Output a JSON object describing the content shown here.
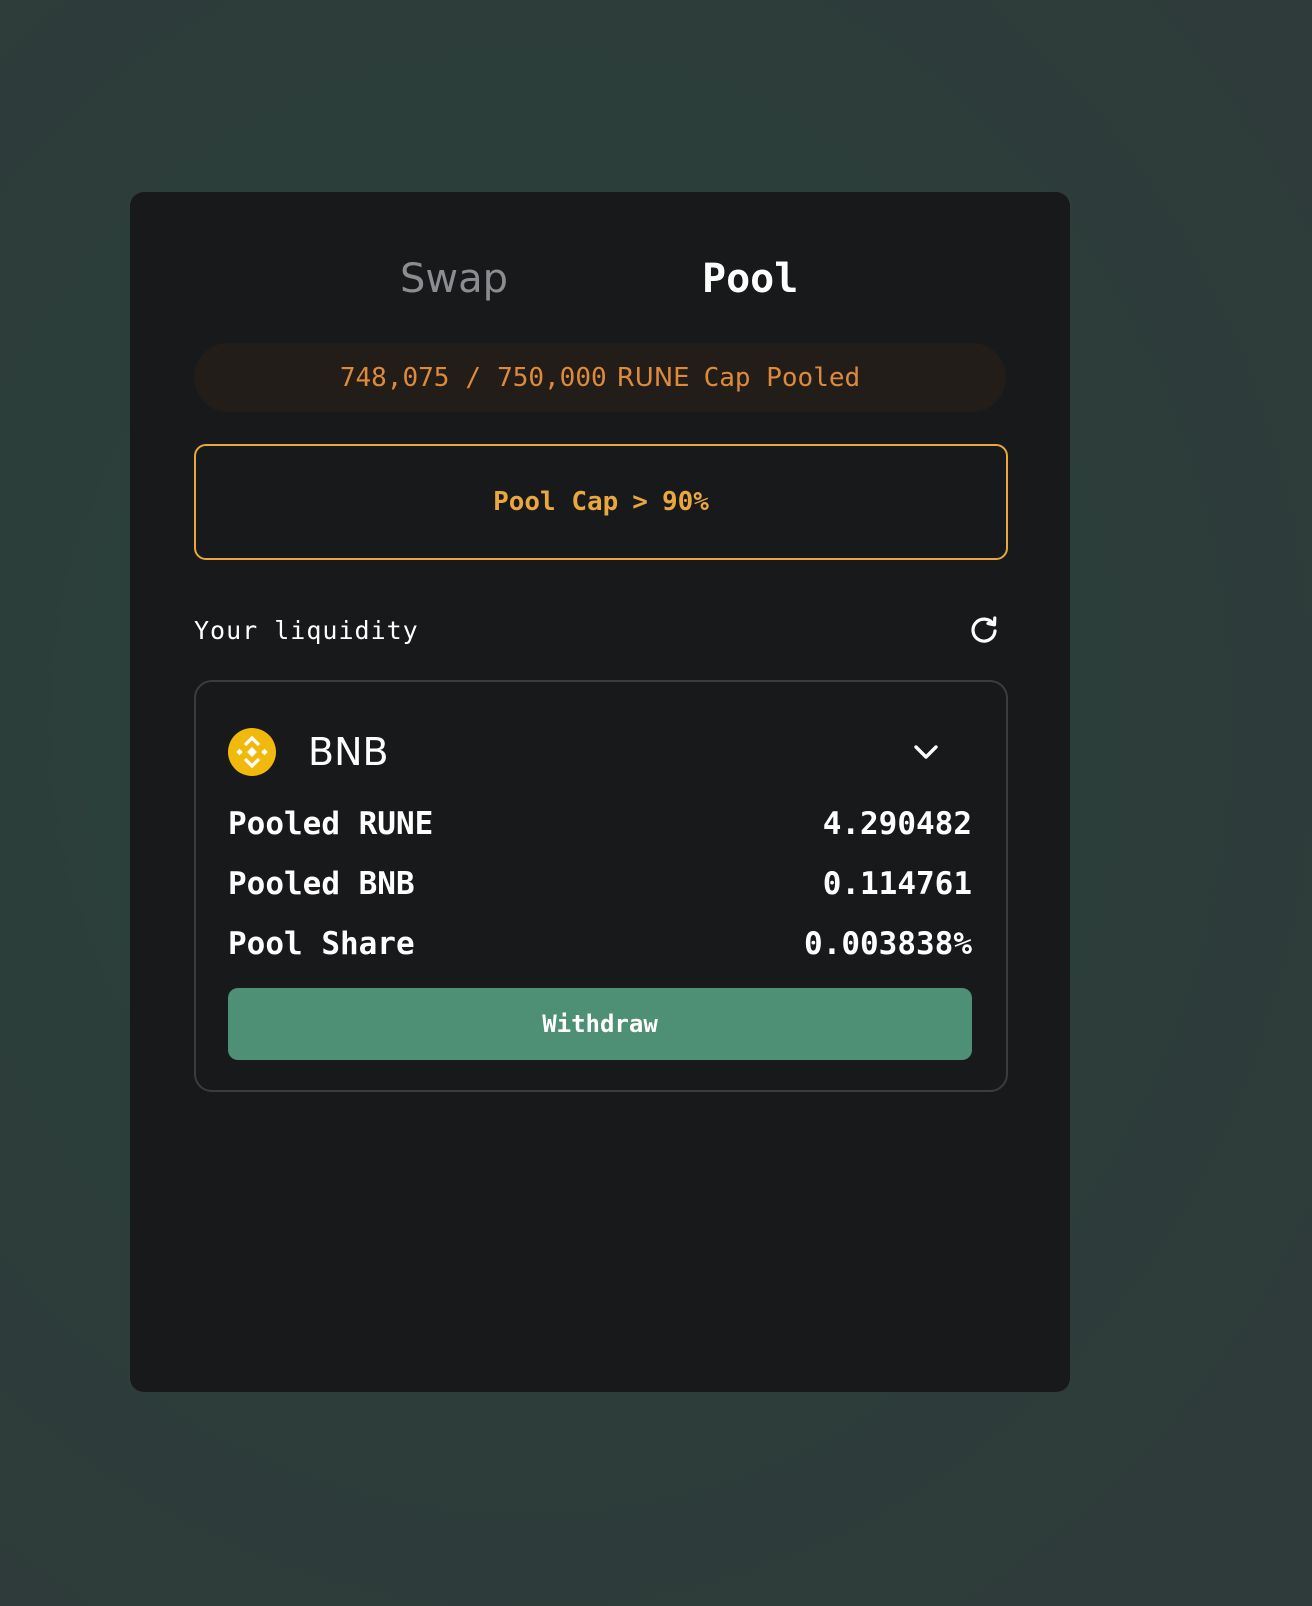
{
  "tabs": {
    "swap_label": "Swap",
    "pool_label": "Pool",
    "active": "Pool"
  },
  "cap": {
    "pooled": "748,075",
    "separator": "/",
    "cap_total": "750,000",
    "ticker": "RUNE",
    "suffix": "Cap Pooled"
  },
  "warning": {
    "label": "Pool Cap",
    "chevron": ">",
    "value": "90%"
  },
  "liquidity": {
    "heading": "Your liquidity",
    "refresh_icon": "refresh-icon"
  },
  "position": {
    "asset": "BNB",
    "asset_icon": "bnb-logo-icon",
    "expand_icon": "chevron-down-icon",
    "rows": [
      {
        "label": "Pooled RUNE",
        "value": "4.290482"
      },
      {
        "label": "Pooled BNB",
        "value": "0.114761"
      },
      {
        "label": "Pool Share",
        "value": "0.003838%"
      }
    ],
    "withdraw_label": "Withdraw"
  },
  "colors": {
    "background": "#2c3e3a",
    "card": "#18191b",
    "cap_text": "#de8a3c",
    "warning": "#e9a73d",
    "bnb_yellow": "#f0b90b",
    "button": "#4e9075"
  }
}
